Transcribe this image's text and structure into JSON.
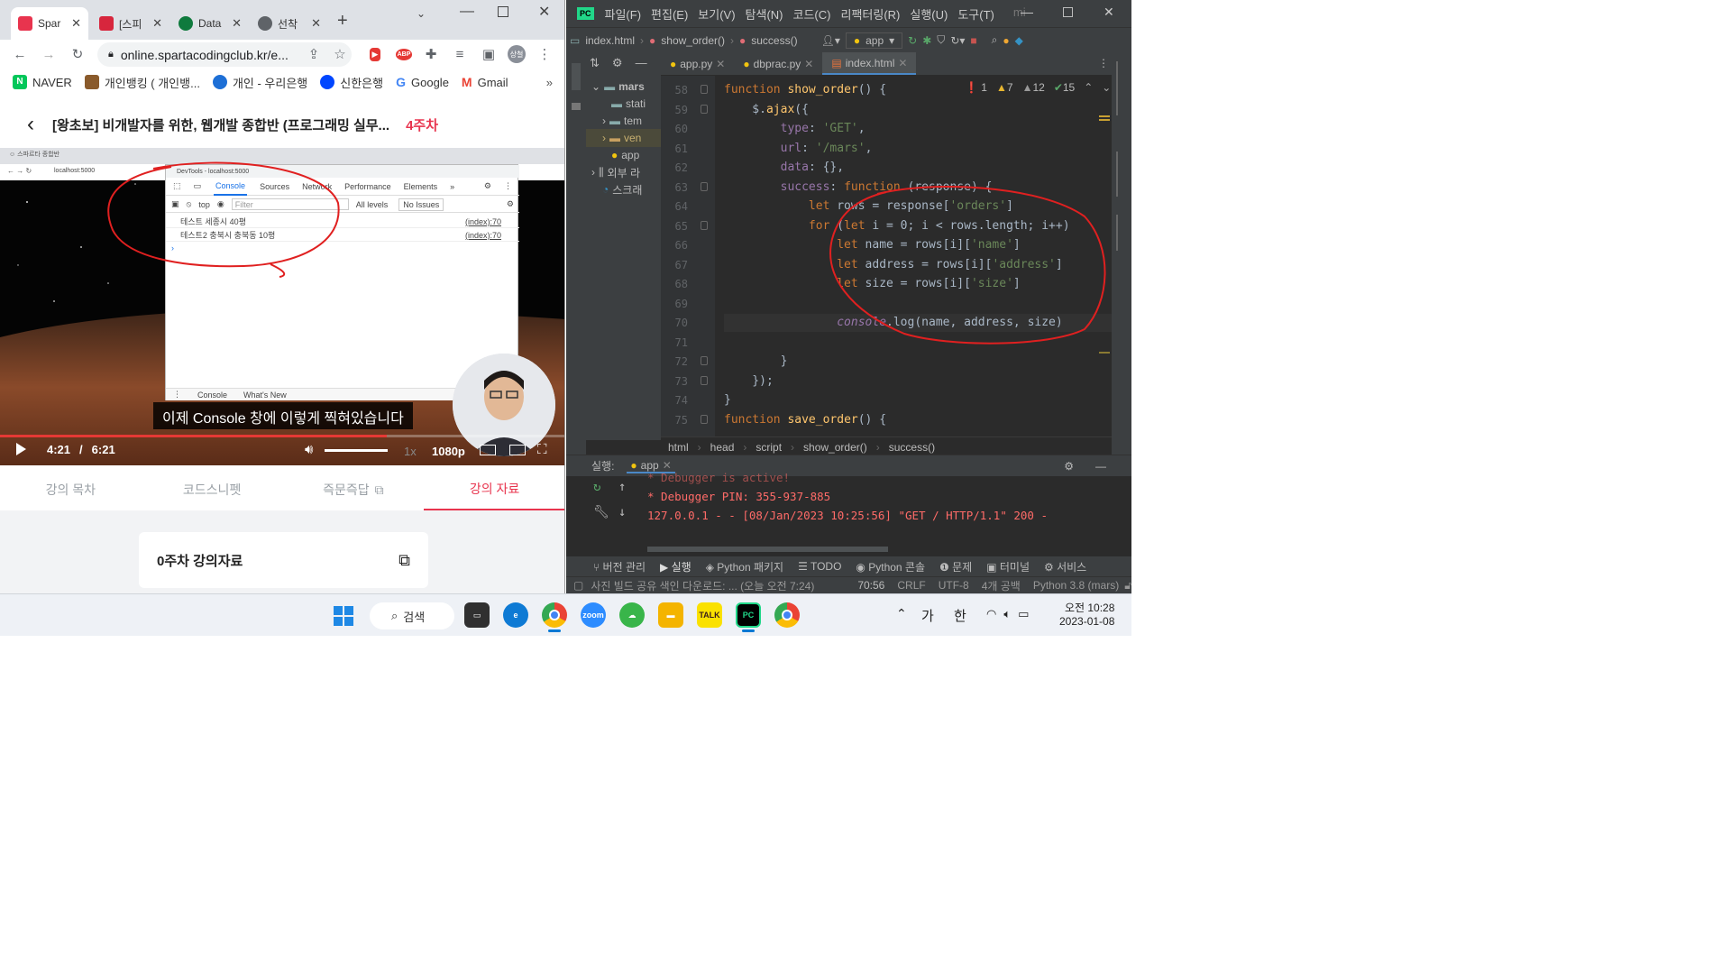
{
  "chrome": {
    "tabs": [
      {
        "label": "Spar",
        "color": "#e8344e"
      },
      {
        "label": "[스피",
        "color": "#d7263d"
      },
      {
        "label": "Data",
        "color": "#0f7a3d"
      },
      {
        "label": "선착",
        "color": "#5f6368"
      }
    ],
    "url": "online.spartacodingclub.kr/e...",
    "bookmarks": [
      "NAVER",
      "개인뱅킹 ( 개인뱅...",
      "개인 - 우리은행",
      "신한은행",
      "Google",
      "Gmail"
    ],
    "profile": "상철"
  },
  "page": {
    "course_title": "[왕초보] 비개발자를 위한, 웹개발 종합반 (프로그래밍 실무...",
    "week": "4주차",
    "subtitle": "이제 Console 창에 이렇게 찍혀있습니다",
    "time_current": "4:21",
    "time_sep": "/",
    "time_total": "6:21",
    "progress": 0.685,
    "speed": "1x",
    "quality": "1080p",
    "tabs": [
      "강의 목차",
      "코드스니펫",
      "즉문즉답",
      "강의 자료"
    ],
    "active_tab": 3,
    "material_card": "0주차 강의자료"
  },
  "devtools": {
    "title": "DevTools - localhost:5000",
    "tabs": [
      "Console",
      "Sources",
      "Network",
      "Performance",
      "Elements"
    ],
    "context": "top",
    "filter_placeholder": "Filter",
    "levels": "All levels",
    "issues": "No Issues",
    "logs": [
      {
        "text": "테스트 세종시 40평",
        "src": "(index):70"
      },
      {
        "text": "테스트2 충북시 충북동 10평",
        "src": "(index):70"
      }
    ],
    "drawer_tabs": [
      "Console",
      "What's New"
    ],
    "inner_url": "localhost:5000"
  },
  "pycharm": {
    "menu": [
      "파일(F)",
      "편집(E)",
      "보기(V)",
      "탐색(N)",
      "코드(C)",
      "리팩터링(R)",
      "실행(U)",
      "도구(T)",
      "mi"
    ],
    "nav": [
      "index.html",
      "show_order()",
      "success()"
    ],
    "run_config": "app",
    "project_tree": [
      "mars",
      "stati",
      "tem",
      "ven",
      "app",
      "외부 라",
      "스크래"
    ],
    "editor_tabs": [
      "app.py",
      "dbprac.py",
      "index.html"
    ],
    "inspections": {
      "errors": "1",
      "warnings": "7",
      "weak": "12",
      "typos": "15"
    },
    "lines": [
      {
        "n": "58",
        "code": "function show_order() {"
      },
      {
        "n": "59",
        "code": "    $.ajax({"
      },
      {
        "n": "60",
        "code": "        type: 'GET',"
      },
      {
        "n": "61",
        "code": "        url: '/mars',"
      },
      {
        "n": "62",
        "code": "        data: {},"
      },
      {
        "n": "63",
        "code": "        success: function (response) {"
      },
      {
        "n": "64",
        "code": "            let rows = response['orders']"
      },
      {
        "n": "65",
        "code": "            for (let i = 0; i < rows.length; i++)"
      },
      {
        "n": "66",
        "code": "                let name = rows[i]['name']"
      },
      {
        "n": "67",
        "code": "                let address = rows[i]['address']"
      },
      {
        "n": "68",
        "code": "                let size = rows[i]['size']"
      },
      {
        "n": "69",
        "code": ""
      },
      {
        "n": "70",
        "code": "                console.log(name, address, size)"
      },
      {
        "n": "71",
        "code": ""
      },
      {
        "n": "72",
        "code": "        }"
      },
      {
        "n": "73",
        "code": "    });"
      },
      {
        "n": "74",
        "code": "}"
      },
      {
        "n": "75",
        "code": "function save_order() {"
      }
    ],
    "breadcrumbs": [
      "html",
      "head",
      "script",
      "show_order()",
      "success()"
    ],
    "run_label": "실행:",
    "run_tab": "app",
    "run_output": [
      " * Debugger is active!",
      " * Debugger PIN: 355-937-885",
      "127.0.0.1 - - [08/Jan/2023 10:25:56] \"GET / HTTP/1.1\" 200 -"
    ],
    "bottom_tools": [
      "버전 관리",
      "실행",
      "Python 패키지",
      "TODO",
      "Python 콘솔",
      "문제",
      "터미널",
      "서비스"
    ],
    "status": {
      "message": "사진 빌드 공유 색인 다운로드: ... (오늘 오전 7:24)",
      "position": "70:56",
      "line_sep": "CRLF",
      "encoding": "UTF-8",
      "indent": "4개 공백",
      "interpreter": "Python 3.8 (mars)"
    }
  },
  "taskbar": {
    "search": "검색",
    "ime_1": "가",
    "ime_2": "한",
    "time": "오전 10:28",
    "date": "2023-01-08"
  }
}
